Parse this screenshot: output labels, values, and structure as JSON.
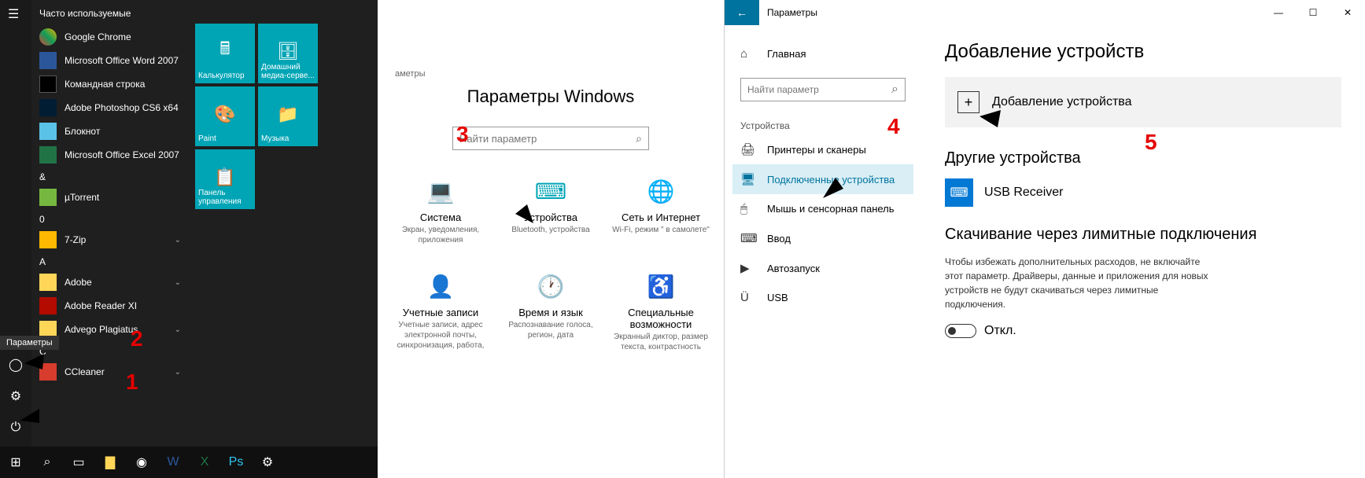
{
  "start_menu": {
    "frequent_header": "Часто используемые",
    "tooltip": "Параметры",
    "apps": [
      {
        "name": "Google Chrome",
        "icon": "ai-chrome"
      },
      {
        "name": "Microsoft Office Word 2007",
        "icon": "ai-word"
      },
      {
        "name": "Командная строка",
        "icon": "ai-cmd"
      },
      {
        "name": "Adobe Photoshop CS6 x64",
        "icon": "ai-ps"
      },
      {
        "name": "Блокнот",
        "icon": "ai-note"
      },
      {
        "name": "Microsoft Office Excel 2007",
        "icon": "ai-excel"
      }
    ],
    "groups": [
      {
        "letter": "&",
        "items": [
          {
            "name": "µTorrent",
            "icon": "ai-ut"
          }
        ]
      },
      {
        "letter": "0",
        "items": [
          {
            "name": "7-Zip",
            "icon": "ai-zip",
            "expand": true
          }
        ]
      },
      {
        "letter": "A",
        "items": [
          {
            "name": "Adobe",
            "icon": "ai-folder",
            "expand": true
          },
          {
            "name": "Adobe Reader XI",
            "icon": "ai-pdf"
          },
          {
            "name": "Advego Plagiatus",
            "icon": "ai-folder",
            "expand": true
          }
        ]
      },
      {
        "letter": "C",
        "items": [
          {
            "name": "CCleaner",
            "icon": "ai-cc",
            "expand": true
          }
        ]
      }
    ],
    "tiles": [
      {
        "label": "Калькулятор",
        "icon": "🖩"
      },
      {
        "label": "Домашний медиа-серве...",
        "icon": "🗄"
      },
      {
        "label": "Paint",
        "icon": "🎨"
      },
      {
        "label": "Музыка",
        "icon": "📁"
      },
      {
        "label": "Панель управления",
        "icon": "📋"
      }
    ]
  },
  "settings_main": {
    "crumb": "аметры",
    "title": "Параметры Windows",
    "search_placeholder": "Найти параметр",
    "categories": [
      {
        "name": "Система",
        "desc": "Экран, уведомления, приложения",
        "icon": "💻"
      },
      {
        "name": "Устройства",
        "desc": "Bluetooth, устройства",
        "icon": "⌨"
      },
      {
        "name": "Сеть и Интернет",
        "desc": "Wi-Fi, режим \" в самолете\"",
        "icon": "🌐"
      },
      {
        "name": "Учетные записи",
        "desc": "Учетные записи, адрес электронной почты, синхронизация, работа,",
        "icon": "👤"
      },
      {
        "name": "Время и язык",
        "desc": "Распознавание голоса, регион, дата",
        "icon": "🕐"
      },
      {
        "name": "Специальные возможности",
        "desc": "Экранный диктор, размер текста, контрастность",
        "icon": "♿"
      }
    ]
  },
  "devices": {
    "window_title": "Параметры",
    "home": "Главная",
    "search_placeholder": "Найти параметр",
    "category_header": "Устройства",
    "nav": [
      {
        "label": "Принтеры и сканеры",
        "icon": "🖨"
      },
      {
        "label": "Подключенные устройства",
        "icon": "🖥",
        "active": true
      },
      {
        "label": "Мышь и сенсорная панель",
        "icon": "🖱"
      },
      {
        "label": "Ввод",
        "icon": "⌨"
      },
      {
        "label": "Автозапуск",
        "icon": "▶"
      },
      {
        "label": "USB",
        "icon": "Ü"
      }
    ],
    "content": {
      "h1": "Добавление устройств",
      "add_button": "Добавление устройства",
      "other_header": "Другие устройства",
      "device_name": "USB Receiver",
      "metered_header": "Скачивание через лимитные подключения",
      "metered_desc": "Чтобы избежать дополнительных расходов, не включайте этот параметр. Драйверы, данные и приложения для новых устройств не будут скачиваться через лимитные подключения.",
      "toggle_label": "Откл."
    }
  },
  "annotations": {
    "n1": "1",
    "n2": "2",
    "n3": "3",
    "n4": "4",
    "n5": "5"
  }
}
